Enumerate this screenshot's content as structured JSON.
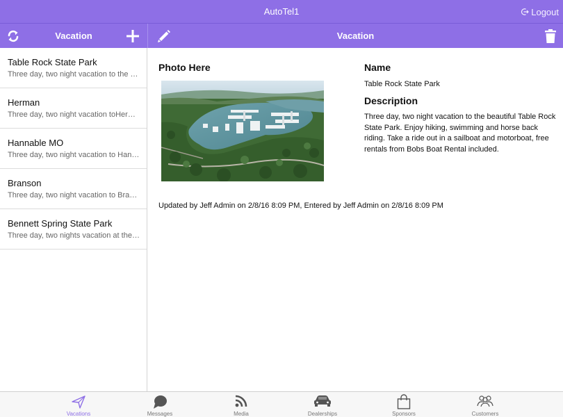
{
  "app": {
    "title": "AutoTel1",
    "logout_label": "Logout"
  },
  "list_header": {
    "title": "Vacation"
  },
  "detail_header": {
    "title": "Vacation"
  },
  "vacations": [
    {
      "title": "Table Rock State Park",
      "subtitle": "Three day, two night vacation to the beautiful Table Rock State Park"
    },
    {
      "title": "Herman",
      "subtitle": "Three day, two night vacation toHerman Missouri"
    },
    {
      "title": "Hannable MO",
      "subtitle": "Three day, two night vacation to Hannable Missouri"
    },
    {
      "title": "Branson",
      "subtitle": "Three day, two night vacation to Branson Missouri"
    },
    {
      "title": "Bennett Spring State Park",
      "subtitle": "Three day, two nights vacation at the Bennett Spring State Park"
    }
  ],
  "detail": {
    "photo_heading": "Photo Here",
    "name_heading": "Name",
    "name_value": "Table Rock State Park",
    "description_heading": "Description",
    "description_value": "Three day, two night vacation to the beautiful Table Rock State Park. Enjoy hiking, swimming and horse back riding. Take a ride out in a sailboat and motorboat, free rentals from Bobs Boat Rental included.",
    "updated_text": "Updated by Jeff Admin on 2/8/16 8:09 PM, Entered by Jeff Admin on 2/8/16 8:09 PM"
  },
  "tabs": [
    {
      "label": "Vacations",
      "icon": "paper-plane-icon",
      "active": true
    },
    {
      "label": "Messages",
      "icon": "chat-bubble-icon",
      "active": false
    },
    {
      "label": "Media",
      "icon": "rss-icon",
      "active": false
    },
    {
      "label": "Dealerships",
      "icon": "car-icon",
      "active": false
    },
    {
      "label": "Sponsors",
      "icon": "shopping-bag-icon",
      "active": false
    },
    {
      "label": "Customers",
      "icon": "people-icon",
      "active": false
    }
  ],
  "colors": {
    "accent": "#8e6fe6",
    "tab_inactive": "#777777",
    "icon_inactive": "#555555"
  }
}
